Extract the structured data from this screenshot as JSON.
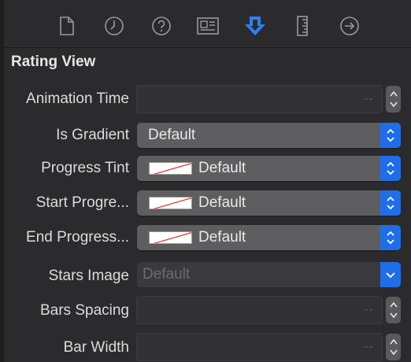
{
  "toolbar": {
    "icons": [
      "file-icon",
      "clock-icon",
      "help-icon",
      "identity-icon",
      "attributes-icon",
      "ruler-icon",
      "connections-icon"
    ],
    "active_color": "#2d7ff9"
  },
  "section": {
    "title": "Rating View"
  },
  "fields": {
    "animation_time": {
      "label": "Animation Time",
      "placeholder": "--"
    },
    "is_gradient": {
      "label": "Is Gradient",
      "value": "Default"
    },
    "progress_tint": {
      "label": "Progress Tint",
      "value": "Default"
    },
    "start_progress": {
      "label": "Start Progre...",
      "value": "Default"
    },
    "end_progress": {
      "label": "End Progress...",
      "value": "Default"
    },
    "stars_image": {
      "label": "Stars Image",
      "value": "Default"
    },
    "bars_spacing": {
      "label": "Bars Spacing",
      "placeholder": "--"
    },
    "bar_width": {
      "label": "Bar Width",
      "placeholder": "--"
    }
  },
  "colors": {
    "popup_accent": "#1f6ee8",
    "no_color_slash": "#e0302a"
  }
}
